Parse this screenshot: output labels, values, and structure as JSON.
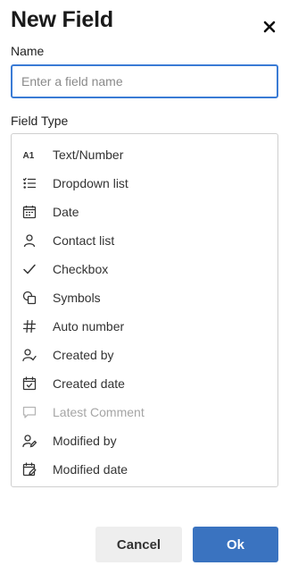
{
  "dialog": {
    "title": "New Field",
    "close_icon": "close-icon"
  },
  "name": {
    "label": "Name",
    "value": "",
    "placeholder": "Enter a field name"
  },
  "field_type": {
    "label": "Field Type",
    "options": [
      {
        "label": "Text/Number",
        "icon": "text-number-icon",
        "enabled": true
      },
      {
        "label": "Dropdown list",
        "icon": "dropdown-list-icon",
        "enabled": true
      },
      {
        "label": "Date",
        "icon": "calendar-icon",
        "enabled": true
      },
      {
        "label": "Contact list",
        "icon": "person-icon",
        "enabled": true
      },
      {
        "label": "Checkbox",
        "icon": "checkmark-icon",
        "enabled": true
      },
      {
        "label": "Symbols",
        "icon": "symbols-icon",
        "enabled": true
      },
      {
        "label": "Auto number",
        "icon": "hash-icon",
        "enabled": true
      },
      {
        "label": "Created by",
        "icon": "person-check-icon",
        "enabled": true
      },
      {
        "label": "Created date",
        "icon": "calendar-check-icon",
        "enabled": true
      },
      {
        "label": "Latest Comment",
        "icon": "comment-icon",
        "enabled": false
      },
      {
        "label": "Modified by",
        "icon": "person-edit-icon",
        "enabled": true
      },
      {
        "label": "Modified date",
        "icon": "calendar-edit-icon",
        "enabled": true
      }
    ]
  },
  "footer": {
    "cancel_label": "Cancel",
    "ok_label": "Ok"
  },
  "colors": {
    "primary": "#3a73c0",
    "focus_border": "#3a7bd5",
    "disabled_text": "#a5a5a5"
  }
}
